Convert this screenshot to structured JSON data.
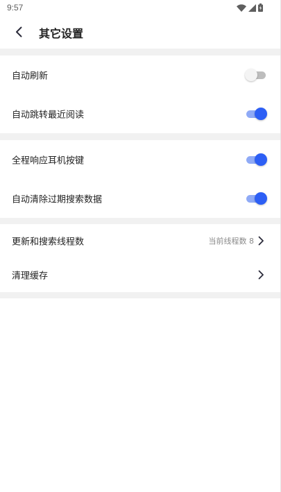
{
  "status_bar": {
    "time": "9:57",
    "icons": [
      "wifi-icon",
      "cellular-signal-icon",
      "battery-icon"
    ]
  },
  "header": {
    "back_icon": "chevron-left-icon",
    "title": "其它设置"
  },
  "settings": {
    "auto_refresh": {
      "label": "自动刷新",
      "enabled": false
    },
    "auto_jump_recent": {
      "label": "自动跳转最近阅读",
      "enabled": true
    },
    "earphone_keys": {
      "label": "全程响应耳机按键",
      "enabled": true
    },
    "auto_clear_search": {
      "label": "自动清除过期搜索数据",
      "enabled": true
    },
    "thread_count": {
      "label": "更新和搜索线程数",
      "value": "当前线程数 8"
    },
    "clear_cache": {
      "label": "清理缓存"
    }
  },
  "colors": {
    "accent": "#2d5ff5",
    "accent_track": "#8faaf6",
    "section_gap": "#f1f1f1",
    "text_primary": "#222222",
    "text_secondary": "#8a8a8a"
  }
}
